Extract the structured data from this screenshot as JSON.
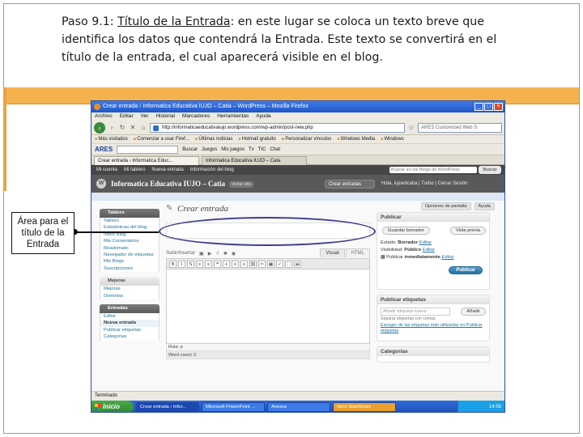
{
  "caption": {
    "step": "Paso 9.1:",
    "topic": "Título de la Entrada",
    "text": ": en este lugar se coloca un texto breve que identifica los datos que contendrá la Entrada. Este texto se convertirá en el título de la entrada, el cual aparecerá visible en el blog."
  },
  "annotation": {
    "label": "Área para el título de la Entrada"
  },
  "browser": {
    "window_title": "Crear entrada ‹ Informatica Educativa IUJO – Catia – WordPress – Mozilla Firefox",
    "window_buttons": {
      "minimize": "_",
      "maximize": "□",
      "close": "×"
    },
    "menu": [
      "Archivo",
      "Editar",
      "Ver",
      "Historial",
      "Marcadores",
      "Herramientas",
      "Ayuda"
    ],
    "url": "http://informaticaeducativaiujo.wordpress.com/wp-admin/post-new.php",
    "search_placeholder": "ARES Customized Web S",
    "bookmarks": [
      "Más visitados",
      "Comenzar a usar Firef...",
      "Últimas noticias",
      "Hotmail gratuito",
      "Personalizar vínculos",
      "Windows Media",
      "Windows"
    ],
    "ares_logo": "ARES",
    "toolbar2_items": [
      "Buscar",
      "Juegos",
      "Mis juegos",
      "Tv",
      "TIC",
      "Chat"
    ],
    "tabs": [
      {
        "label": "Crear entrada ‹ Informatica Educ...",
        "active": true
      },
      {
        "label": "Informatica Educativa IUJO – Cata",
        "active": false
      }
    ],
    "statusbar": "Terminado"
  },
  "wp": {
    "admin_bar": [
      "Mi cuenta",
      "Mi tablero",
      "Nueva entrada",
      "Información del blog"
    ],
    "admin_search_placeholder": "Buscar en los Blogs de WordPress",
    "admin_search_button": "Buscar",
    "logo": "W",
    "blog_title": "Informatica Educativa IUJO – Catia",
    "visit_site": "Visitar sitio",
    "entries_dropdown": "Crear entradas",
    "user_links": "Hola, iujoedcatia | Turbo | Cerrar Sesión",
    "screen_options": "Opciones de pantalla",
    "help": "Ayuda",
    "page_heading": "Crear entrada",
    "menu": {
      "tablero": "Tablero",
      "tablero_items": [
        "Tablero",
        "Estadísticas del blog",
        "Inbox Blog",
        "Mis Comentarios",
        "Readomatic",
        "Navegador de etiquetas",
        "Mis Blogs",
        "Suscripciones"
      ],
      "mejoras": "Mejoras",
      "mejoras_items": [
        "Mejoras",
        "Dominios"
      ],
      "entradas": "Entradas",
      "entradas_items": [
        "Editar",
        "Nueva entrada",
        "Publicar etiquetas",
        "Categorías"
      ]
    },
    "editor": {
      "upload_label": "Subir/Insertar",
      "tab_visual": "Visual",
      "tab_html": "HTML",
      "format_buttons": [
        "B",
        "I",
        "S",
        "≡",
        "≡",
        "❝",
        "≡",
        "≡",
        "≡",
        "⛓",
        "✂",
        "▦",
        "✓",
        "⛶",
        "▤"
      ],
      "path": "Ruta: p",
      "word_count": "Word count: 0"
    },
    "publish": {
      "title": "Publicar",
      "save_draft": "Guardar borrador",
      "preview": "Vista previa",
      "status_label": "Estado:",
      "status_value": "Borrador",
      "status_link": "Editar",
      "visibility_label": "Visibilidad:",
      "visibility_value": "Público",
      "visibility_link": "Editar",
      "schedule_label": "Publicar",
      "schedule_value": "inmediatamente",
      "schedule_link": "Editar",
      "publish_button": "Publicar"
    },
    "tags": {
      "title": "Publicar etiquetas",
      "placeholder": "Añadir etiqueta nueva",
      "add_button": "Añadir",
      "note": "Separar etiquetas con comas.",
      "choose_link": "Escoger de las etiquetas más utilizadas en Publicar etiquetas"
    },
    "categories": {
      "title": "Categorías"
    }
  },
  "taskbar": {
    "start": "Inicio",
    "items": [
      {
        "label": "Crear entrada ‹ Infor...",
        "style": "active"
      },
      {
        "label": "Microsoft PowerPoint ...",
        "style": "normal"
      },
      {
        "label": "Anexos",
        "style": "normal"
      },
      {
        "label": "Nero StartSmart",
        "style": "orange"
      }
    ],
    "clock": "14:56"
  }
}
